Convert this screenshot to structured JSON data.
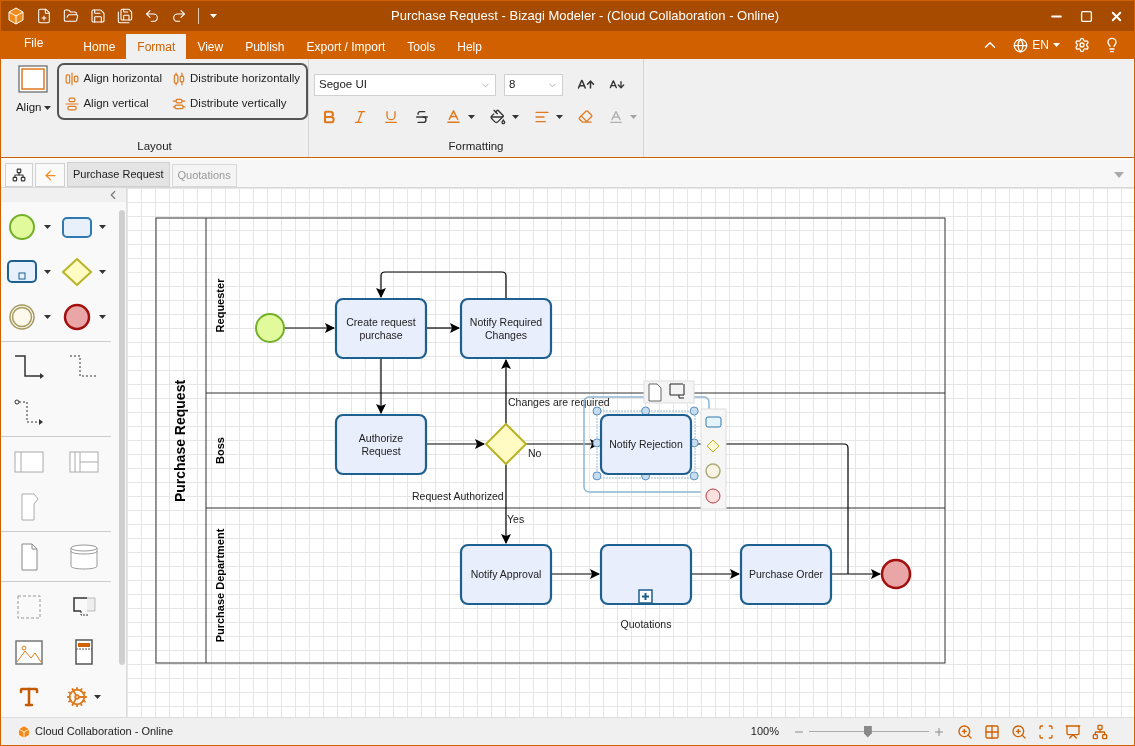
{
  "window": {
    "title": "Purchase Request - Bizagi Modeler - (Cloud Collaboration - Online)"
  },
  "menu": {
    "file": "File",
    "tabs": [
      {
        "label": "Home",
        "selected": false
      },
      {
        "label": "Format",
        "selected": true
      },
      {
        "label": "View",
        "selected": false
      },
      {
        "label": "Publish",
        "selected": false
      },
      {
        "label": "Export / Import",
        "selected": false
      },
      {
        "label": "Tools",
        "selected": false
      },
      {
        "label": "Help",
        "selected": false
      }
    ],
    "language": "EN"
  },
  "ribbon": {
    "align": "Align",
    "layout_buttons": [
      {
        "label": "Align horizontal",
        "kind": "align-horizontal"
      },
      {
        "label": "Distribute horizontally",
        "kind": "distribute-horizontal"
      },
      {
        "label": "Align vertical",
        "kind": "align-vertical"
      },
      {
        "label": "Distribute vertically",
        "kind": "distribute-vertical"
      }
    ],
    "font": "Segoe UI",
    "size": "8",
    "groups": [
      "Layout",
      "Formatting"
    ]
  },
  "doc_tabs": [
    {
      "label": "Purchase Request",
      "selected": true
    },
    {
      "label": "Quotations",
      "selected": false
    }
  ],
  "diagram": {
    "pool": "Purchase Request",
    "lanes": [
      "Requester",
      "Boss",
      "Purchase Department"
    ],
    "tasks": [
      {
        "label": "Create request purchase",
        "kind": "task",
        "selected": false
      },
      {
        "label": "Notify Required Changes",
        "kind": "task",
        "selected": false
      },
      {
        "label": "Authorize Request",
        "kind": "task",
        "selected": false
      },
      {
        "label": "Notify Rejection",
        "kind": "task",
        "selected": true
      },
      {
        "label": "Notify Approval",
        "kind": "task",
        "selected": false
      },
      {
        "label": "Quotations",
        "kind": "subprocess",
        "selected": false
      },
      {
        "label": "Purchase Order",
        "kind": "task",
        "selected": false
      }
    ],
    "flow_labels": [
      "Changes are required",
      "No",
      "Request Authorized",
      "Yes"
    ]
  },
  "status_bar": {
    "text": "Cloud Collaboration - Online",
    "zoom": "100%",
    "zoom_slider": {
      "level": 0.49
    }
  }
}
